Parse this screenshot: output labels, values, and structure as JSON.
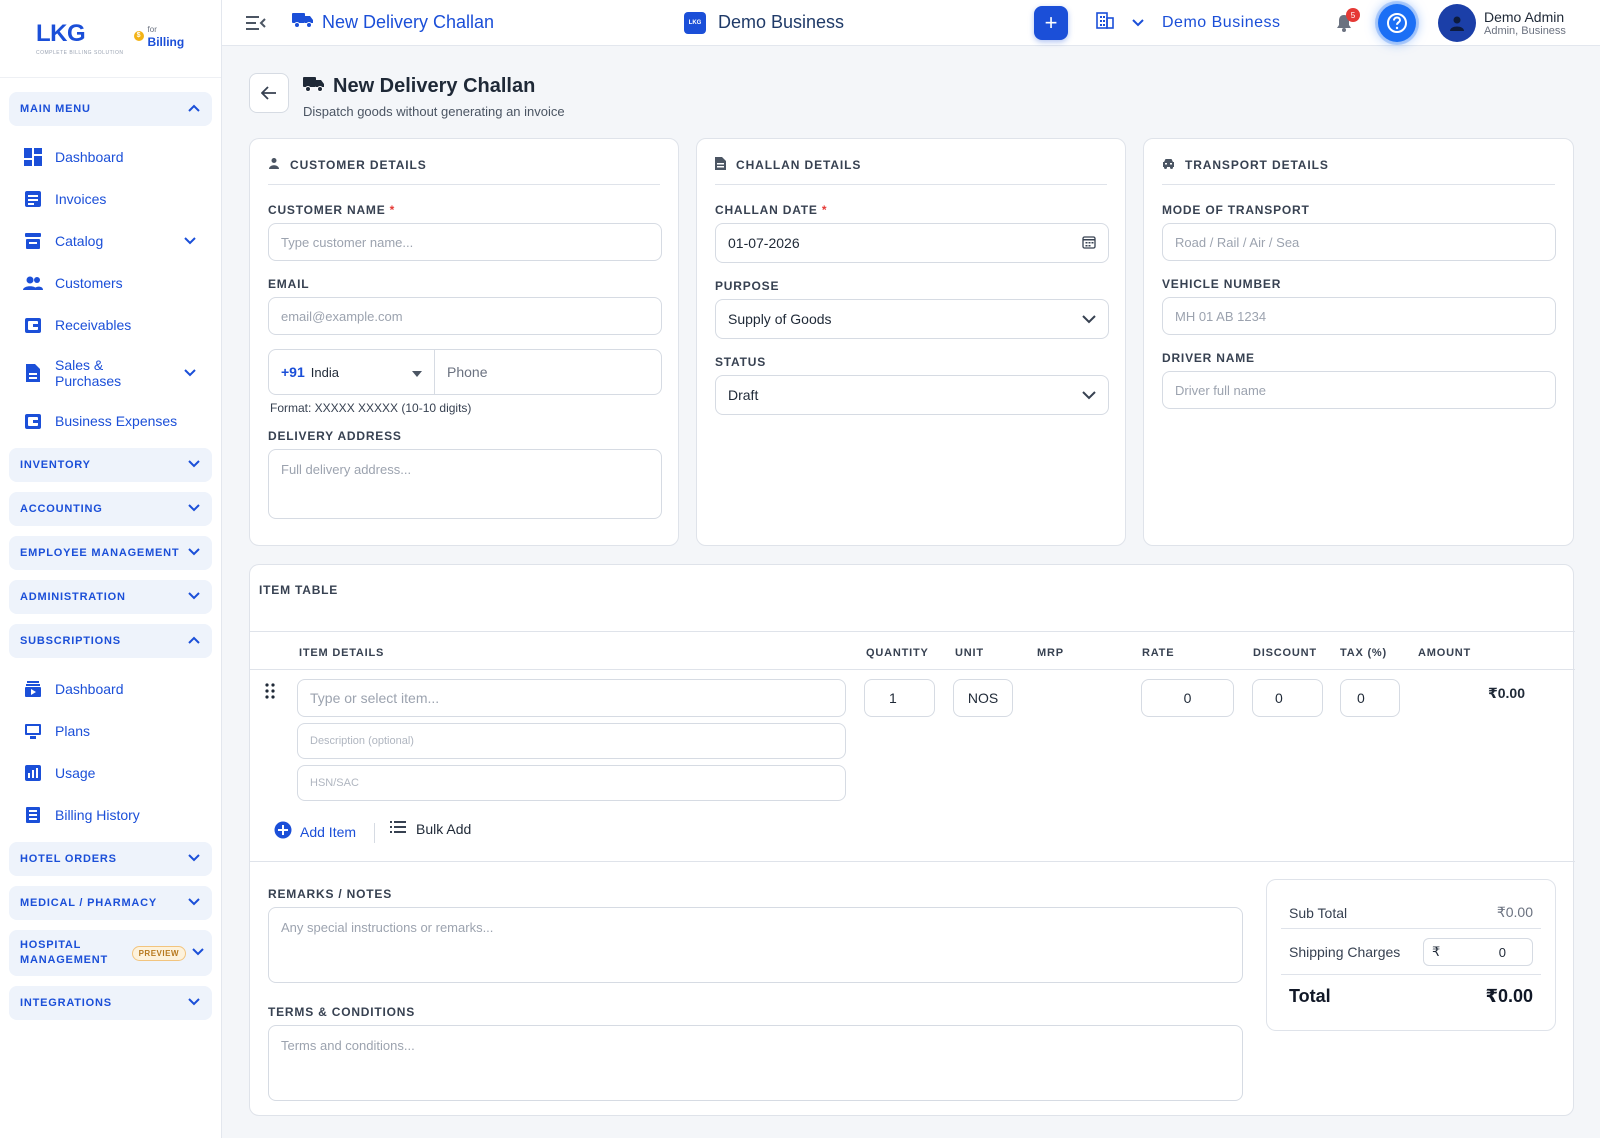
{
  "brand": {
    "name": "LKG",
    "tagline": "COMPLETE BILLING SOLUTION",
    "for_small": "for",
    "for_big": "Billing"
  },
  "sidebar": {
    "main_menu": "MAIN MENU",
    "main_items": [
      {
        "label": "Dashboard",
        "icon": "dashboard-icon"
      },
      {
        "label": "Invoices",
        "icon": "invoice-icon"
      },
      {
        "label": "Catalog",
        "icon": "catalog-icon"
      },
      {
        "label": "Customers",
        "icon": "customers-icon"
      },
      {
        "label": "Receivables",
        "icon": "receivables-icon"
      },
      {
        "label": "Sales & Purchases",
        "icon": "document-icon"
      },
      {
        "label": "Business Expenses",
        "icon": "wallet-icon"
      }
    ],
    "groups": {
      "inventory": "INVENTORY",
      "accounting": "ACCOUNTING",
      "employee": "EMPLOYEE MANAGEMENT",
      "administration": "ADMINISTRATION",
      "subscriptions": "SUBSCRIPTIONS",
      "hotel": "HOTEL ORDERS",
      "medical": "MEDICAL / PHARMACY",
      "hospital": "HOSPITAL MANAGEMENT",
      "hospital_badge": "PREVIEW",
      "integrations": "INTEGRATIONS"
    },
    "sub_items": [
      {
        "label": "Dashboard",
        "icon": "subscription-dashboard-icon"
      },
      {
        "label": "Plans",
        "icon": "plans-icon"
      },
      {
        "label": "Usage",
        "icon": "usage-icon"
      },
      {
        "label": "Billing History",
        "icon": "billing-history-icon"
      }
    ]
  },
  "topbar": {
    "title": "New Delivery Challan",
    "center_business": "Demo Business",
    "business_selector": "Demo Business",
    "notifications": "5",
    "user_name": "Demo Admin",
    "user_role": "Admin, Business"
  },
  "page": {
    "title": "New Delivery Challan",
    "subtitle": "Dispatch goods without generating an invoice"
  },
  "customer": {
    "heading": "CUSTOMER DETAILS",
    "name_label": "CUSTOMER NAME",
    "name_placeholder": "Type customer name...",
    "email_label": "EMAIL",
    "email_placeholder": "email@example.com",
    "country_code": "+91",
    "country": "India",
    "phone_placeholder": "Phone",
    "phone_format": "Format: XXXXX XXXXX (10-10 digits)",
    "address_label": "DELIVERY ADDRESS",
    "address_placeholder": "Full delivery address..."
  },
  "challan": {
    "heading": "CHALLAN DETAILS",
    "date_label": "CHALLAN DATE",
    "date_value": "01-07-2026",
    "purpose_label": "PURPOSE",
    "purpose_value": "Supply of Goods",
    "status_label": "STATUS",
    "status_value": "Draft"
  },
  "transport": {
    "heading": "TRANSPORT DETAILS",
    "mode_label": "MODE OF TRANSPORT",
    "mode_placeholder": "Road / Rail / Air / Sea",
    "vehicle_label": "VEHICLE NUMBER",
    "vehicle_placeholder": "MH 01 AB 1234",
    "driver_label": "DRIVER NAME",
    "driver_placeholder": "Driver full name"
  },
  "items": {
    "heading": "ITEM TABLE",
    "columns": [
      "ITEM DETAILS",
      "QUANTITY",
      "UNIT",
      "MRP",
      "RATE",
      "DISCOUNT",
      "TAX (%)",
      "AMOUNT"
    ],
    "row": {
      "item_placeholder": "Type or select item...",
      "desc_placeholder": "Description (optional)",
      "hsn_placeholder": "HSN/SAC",
      "quantity": "1",
      "unit": "NOS",
      "rate": "0",
      "discount": "0",
      "tax": "0",
      "amount": "₹0.00"
    },
    "add_item": "Add Item",
    "bulk_add": "Bulk Add"
  },
  "notes": {
    "remarks_label": "REMARKS / NOTES",
    "remarks_placeholder": "Any special instructions or remarks...",
    "terms_label": "TERMS & CONDITIONS",
    "terms_placeholder": "Terms and conditions..."
  },
  "summary": {
    "subtotal_label": "Sub Total",
    "subtotal_value": "₹0.00",
    "shipping_label": "Shipping Charges",
    "shipping_currency": "₹",
    "shipping_value": "0",
    "total_label": "Total",
    "total_value": "₹0.00"
  },
  "colors": {
    "accent": "#1b4fd8",
    "required": "#e53935",
    "badge": "#e53935"
  }
}
